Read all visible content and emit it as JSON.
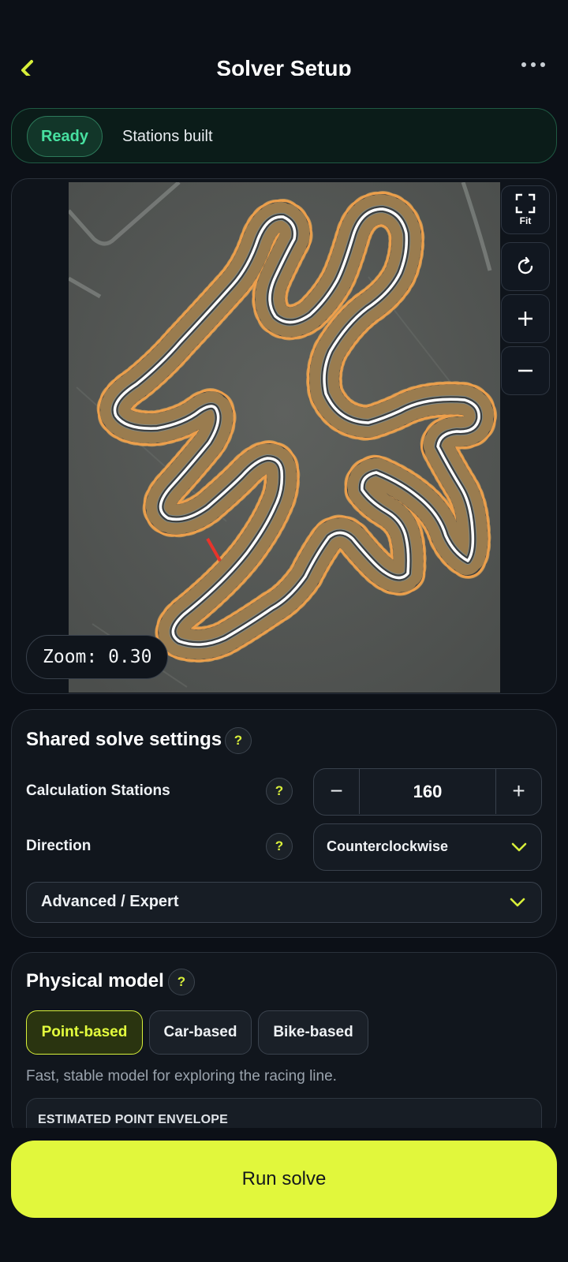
{
  "header": {
    "title": "Solver Setup",
    "back_icon": "chevron-left-icon",
    "menu_icon": "more-icon"
  },
  "status": {
    "badge": "Ready",
    "message": "Stations built"
  },
  "map": {
    "zoom_text": "Zoom: 0.30",
    "controls": {
      "fit_label": "Fit"
    },
    "colors": {
      "outer_edge": "#f3a14a",
      "centerline": "#ffffff",
      "inner_edge": "#58a6e6",
      "stations": "#d9a55a",
      "start_line": "#e8342b",
      "ground": "#5b5e5b"
    }
  },
  "shared": {
    "title": "Shared solve settings",
    "stations": {
      "label": "Calculation Stations",
      "value": "160"
    },
    "direction": {
      "label": "Direction",
      "value": "Counterclockwise"
    },
    "advanced": {
      "label": "Advanced / Expert"
    }
  },
  "physical": {
    "title": "Physical model",
    "options": [
      "Point-based",
      "Car-based",
      "Bike-based"
    ],
    "selected": "Point-based",
    "description": "Fast, stable model for exploring the racing line.",
    "envelope_title": "ESTIMATED POINT ENVELOPE"
  },
  "actions": {
    "run": "Run solve"
  },
  "theme": {
    "accent": "#e1f73c",
    "ready": "#47e0a0",
    "background": "#0c1017"
  }
}
